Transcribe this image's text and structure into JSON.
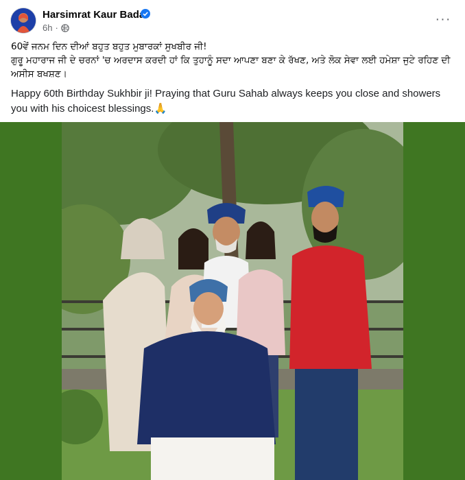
{
  "post": {
    "author": "Harsimrat Kaur Badal",
    "time": "6h",
    "verified": true,
    "more_label": "···",
    "text_punjabi_line1": "60ਵੇਂ ਜਨਮ ਦਿਨ ਦੀਆਂ ਬਹੁਤ ਬਹੁਤ ਮੁਬਾਰਕਾਂ ਸੁਖਬੀਰ ਜੀ!",
    "text_punjabi_line2": "ਗੁਰੂ ਮਹਾਰਾਜ ਜੀ ਦੇ ਚਰਨਾਂ 'ਚ ਅਰਦਾਸ ਕਰਦੀ ਹਾਂ ਕਿ ਤੁਹਾਨੂੰ ਸਦਾ ਆਪਣਾ ਬਣਾ ਕੇ ਰੱਖਣ, ਅਤੇ ਲੋਕ ਸੇਵਾ ਲਈ ਹਮੇਸ਼ਾ ਜੁਟੇ ਰਹਿਣ ਦੀ ਅਸੀਸ ਬਖਸ਼ਣ।",
    "text_english": "Happy 60th Birthday Sukhbir ji! Praying that Guru Sahab always keeps you close and showers you with his choicest blessings.",
    "emoji": "🙏"
  },
  "icons": {
    "verified": "verified-badge-icon",
    "globe": "globe-icon",
    "more": "more-options-icon"
  },
  "colors": {
    "verified_blue": "#1877f2",
    "photo_border_green": "#3f7622"
  }
}
